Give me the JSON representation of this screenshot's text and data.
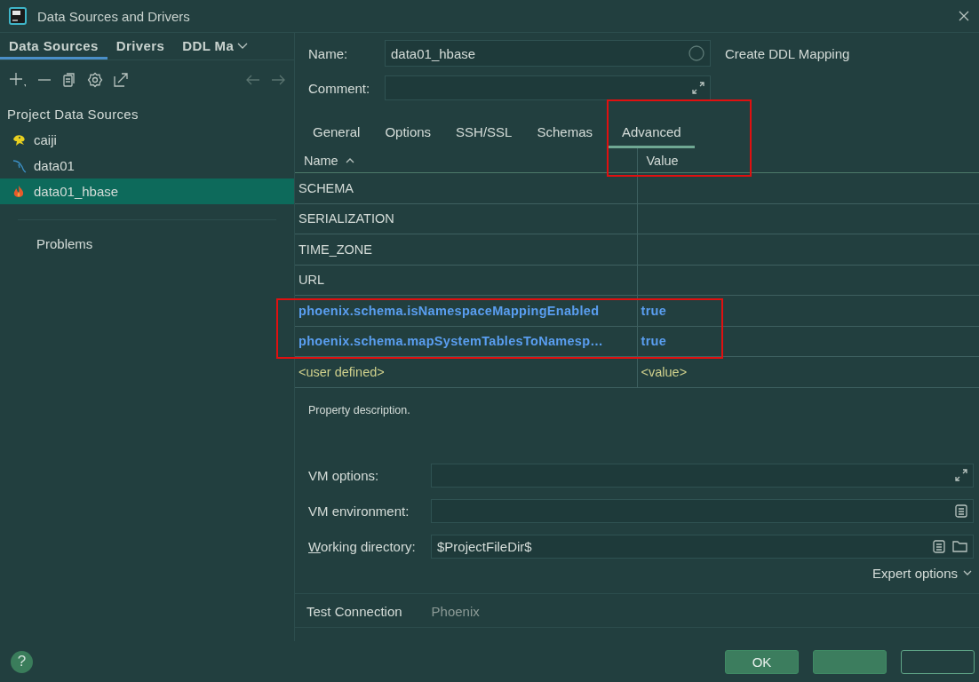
{
  "window": {
    "title": "Data Sources and Drivers"
  },
  "sidebar": {
    "tabs": [
      {
        "label": "Data Sources",
        "selected": true
      },
      {
        "label": "Drivers",
        "selected": false
      },
      {
        "label": "DDL Ma",
        "selected": false
      }
    ],
    "section_title": "Project Data Sources",
    "items": [
      {
        "label": "caiji",
        "kind": "creature",
        "selected": false
      },
      {
        "label": "data01",
        "kind": "dolphin",
        "selected": false
      },
      {
        "label": "data01_hbase",
        "kind": "flame",
        "selected": true
      }
    ],
    "problems": "Problems"
  },
  "form": {
    "name_label": "Name:",
    "name_value": "data01_hbase",
    "create_ddl": "Create DDL Mapping",
    "comment_label": "Comment:"
  },
  "tabs": [
    {
      "label": "General",
      "selected": false
    },
    {
      "label": "Options",
      "selected": false
    },
    {
      "label": "SSH/SSL",
      "selected": false
    },
    {
      "label": "Schemas",
      "selected": false
    },
    {
      "label": "Advanced",
      "selected": true
    }
  ],
  "table": {
    "columns": [
      "Name",
      "Value"
    ],
    "rows": [
      {
        "name": "SCHEMA",
        "kind": "default"
      },
      {
        "name": "SERIALIZATION",
        "kind": "default"
      },
      {
        "name": "TIME_ZONE",
        "kind": "default"
      },
      {
        "name": "URL",
        "kind": "default"
      },
      {
        "name": "phoenix.schema.isNamespaceMappingEnabled",
        "value": "true",
        "kind": "set"
      },
      {
        "name": "phoenix.schema.mapSystemTablesToNamesp…",
        "value": "true",
        "kind": "set"
      },
      {
        "name": "<user defined>",
        "value": "<value>",
        "kind": "new"
      }
    ]
  },
  "description": "Property description.",
  "vm_fields": [
    {
      "label": "VM options:",
      "kind": "expand",
      "mnemonic": false
    },
    {
      "label": "VM environment:",
      "kind": "list",
      "mnemonic": false
    },
    {
      "label": "Working directory:",
      "value": "$ProjectFileDir$",
      "kind": "list-folder",
      "mnemonic": true
    }
  ],
  "expert_options": "Expert options",
  "footer_tabs": [
    {
      "label": "Test Connection",
      "dim": false
    },
    {
      "label": "Phoenix",
      "dim": true
    }
  ],
  "help": "?",
  "buttons": [
    {
      "label": "OK",
      "kind": "filled"
    },
    {
      "kind": "filled"
    },
    {
      "kind": "outlined"
    }
  ]
}
